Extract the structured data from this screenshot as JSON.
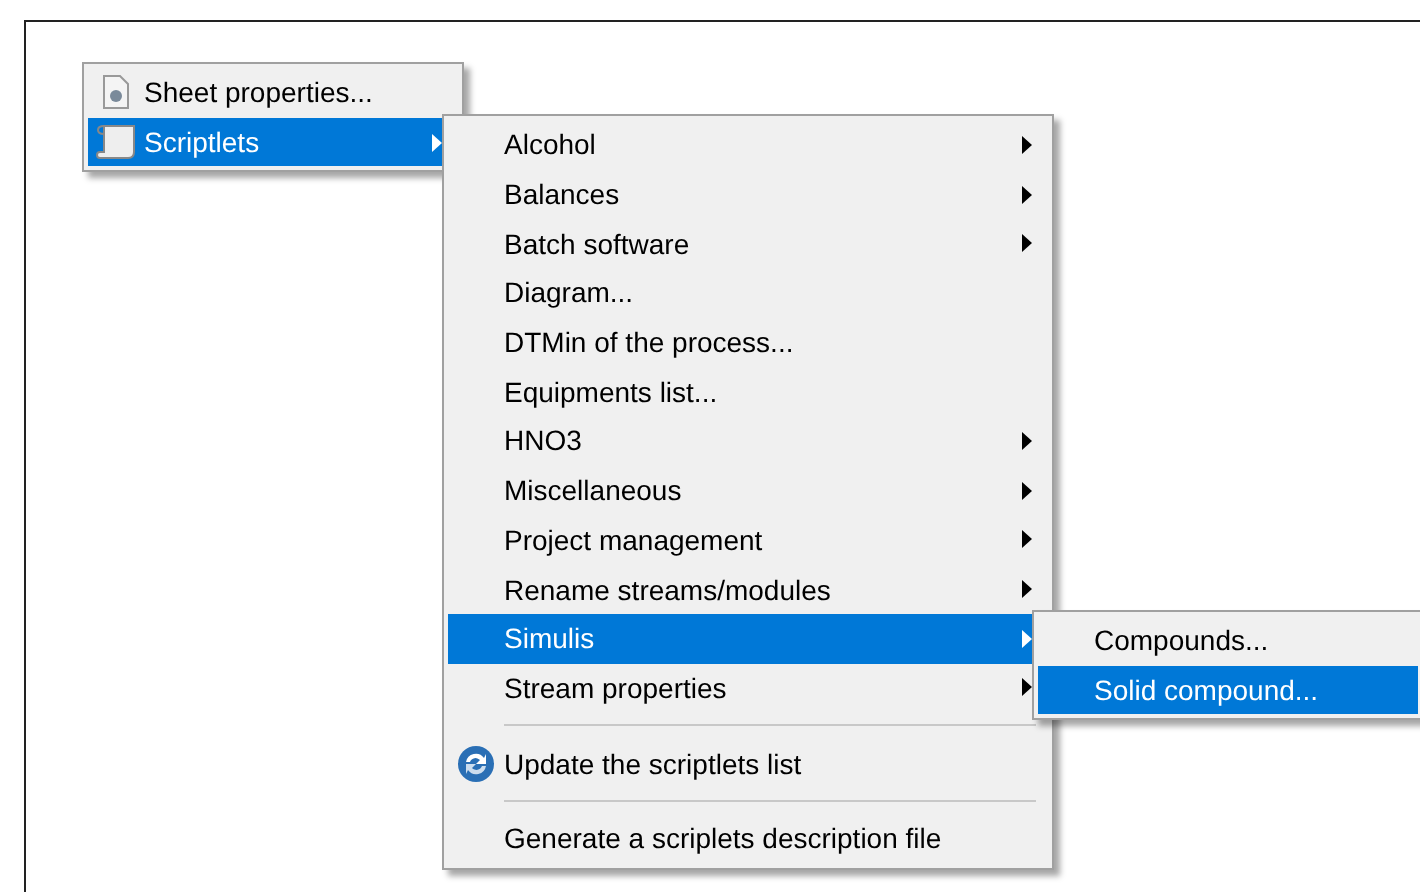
{
  "menus": [
    {
      "items": [
        {
          "kind": "item",
          "label": "Sheet properties...",
          "has_submenu": false,
          "selected": false
        },
        {
          "kind": "item",
          "label": "Scriptlets",
          "has_submenu": true,
          "selected": true
        }
      ]
    },
    {
      "items": [
        {
          "kind": "item",
          "label": "Alcohol",
          "has_submenu": true,
          "selected": false
        },
        {
          "kind": "item",
          "label": "Balances",
          "has_submenu": true,
          "selected": false
        },
        {
          "kind": "item",
          "label": "Batch software",
          "has_submenu": true,
          "selected": false
        },
        {
          "kind": "item",
          "label": "Diagram...",
          "has_submenu": false,
          "selected": false
        },
        {
          "kind": "item",
          "label": "DTMin of the process...",
          "has_submenu": false,
          "selected": false
        },
        {
          "kind": "item",
          "label": "Equipments list...",
          "has_submenu": false,
          "selected": false
        },
        {
          "kind": "item",
          "label": "HNO3",
          "has_submenu": true,
          "selected": false
        },
        {
          "kind": "item",
          "label": "Miscellaneous",
          "has_submenu": true,
          "selected": false
        },
        {
          "kind": "item",
          "label": "Project management",
          "has_submenu": true,
          "selected": false
        },
        {
          "kind": "item",
          "label": "Rename streams/modules",
          "has_submenu": true,
          "selected": false
        },
        {
          "kind": "item",
          "label": "Simulis",
          "has_submenu": true,
          "selected": true
        },
        {
          "kind": "item",
          "label": "Stream properties",
          "has_submenu": true,
          "selected": false
        },
        {
          "kind": "separator"
        },
        {
          "kind": "item",
          "label": "Update the scriptlets list",
          "has_submenu": false,
          "selected": false
        },
        {
          "kind": "separator"
        },
        {
          "kind": "item",
          "label": "Generate a scriplets description file",
          "has_submenu": false,
          "selected": false
        }
      ]
    },
    {
      "items": [
        {
          "kind": "item",
          "label": "Compounds...",
          "has_submenu": false,
          "selected": false
        },
        {
          "kind": "item",
          "label": "Solid compound...",
          "has_submenu": false,
          "selected": true
        }
      ]
    }
  ]
}
